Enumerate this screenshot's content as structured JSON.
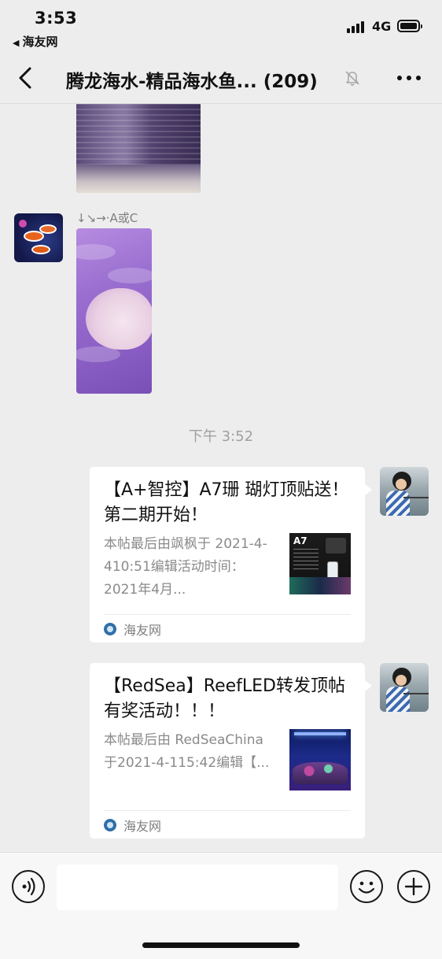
{
  "status_bar": {
    "time": "3:53",
    "back_app": "海友网",
    "network": "4G",
    "signal_bars": 4,
    "battery_level": 0.9
  },
  "nav": {
    "title": "腾龙海水-精品海水鱼... (209)",
    "back_icon": "chevron-left-icon",
    "mute_icon": "bell-slash-icon",
    "more_icon": "ellipsis-icon"
  },
  "messages": [
    {
      "type": "image",
      "image_description": "purple salt jar bottom"
    },
    {
      "type": "image",
      "sender_name": "↓↘→·A或C",
      "avatar": "clownfish-avatar",
      "image_description": "purple bag with white salt"
    }
  ],
  "timestamp": "下午 3:52",
  "cards": [
    {
      "title": "【A+智控】A7珊 瑚灯顶贴送！第二期开始！",
      "description": "本帖最后由飒枫于 2021-4-410:51编辑活动时间：2021年4月...",
      "thumbnail_label": "A7",
      "source": "海友网"
    },
    {
      "title": "【RedSea】ReefLED转发顶帖有奖活动！！！",
      "description": "本帖最后由 RedSeaChina于2021-4-115:42编辑【...",
      "source": "海友网"
    }
  ],
  "input_bar": {
    "voice_icon": "voice-icon",
    "emoji_icon": "emoji-icon",
    "plus_icon": "plus-icon",
    "input_value": ""
  },
  "colors": {
    "background": "#ededed",
    "card_background": "#ffffff",
    "secondary_text": "#8a8a8a",
    "timestamp_text": "#a0a0a0",
    "source_icon": "#2f6fa8"
  }
}
